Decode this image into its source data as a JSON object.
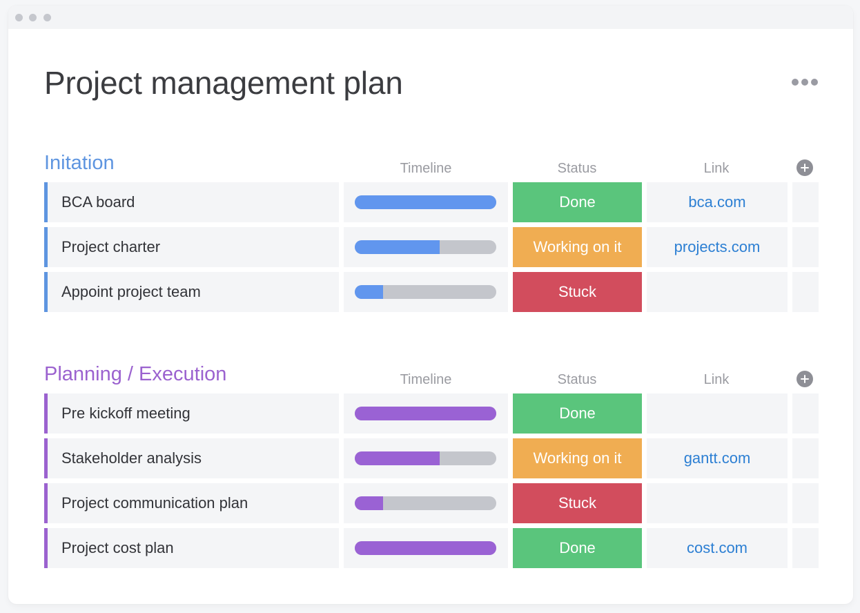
{
  "window": {
    "controls": [
      "dot",
      "dot",
      "dot"
    ]
  },
  "header": {
    "title": "Project management plan",
    "more_icon": "more-horizontal-icon"
  },
  "colors": {
    "done": "#5ac57c",
    "working": "#f0ad52",
    "stuck": "#d24d5d",
    "track": "#c4c6cc",
    "link": "#2c7fd3"
  },
  "groups": [
    {
      "title": "Initation",
      "color": "#5e95e0",
      "accent": "#5e95e0",
      "bar_color": "#6196ee",
      "columns": {
        "timeline": "Timeline",
        "status": "Status",
        "link": "Link"
      },
      "add_column_icon": "plus-circle-icon",
      "rows": [
        {
          "name": "BCA board",
          "progress": 1.0,
          "status": "Done",
          "status_key": "done",
          "link": "bca.com"
        },
        {
          "name": "Project charter",
          "progress": 0.6,
          "status": "Working on it",
          "status_key": "working",
          "link": "projects.com"
        },
        {
          "name": "Appoint project team",
          "progress": 0.2,
          "status": "Stuck",
          "status_key": "stuck",
          "link": ""
        }
      ]
    },
    {
      "title": "Planning / Execution",
      "color": "#9b62cf",
      "accent": "#9b62cf",
      "bar_color": "#9a62d4",
      "columns": {
        "timeline": "Timeline",
        "status": "Status",
        "link": "Link"
      },
      "add_column_icon": "plus-circle-icon",
      "rows": [
        {
          "name": "Pre kickoff meeting",
          "progress": 1.0,
          "status": "Done",
          "status_key": "done",
          "link": ""
        },
        {
          "name": "Stakeholder analysis",
          "progress": 0.6,
          "status": "Working on it",
          "status_key": "working",
          "link": "gantt.com"
        },
        {
          "name": "Project communication plan",
          "progress": 0.2,
          "status": "Stuck",
          "status_key": "stuck",
          "link": ""
        },
        {
          "name": "Project cost plan",
          "progress": 1.0,
          "status": "Done",
          "status_key": "done",
          "link": "cost.com"
        }
      ]
    }
  ]
}
